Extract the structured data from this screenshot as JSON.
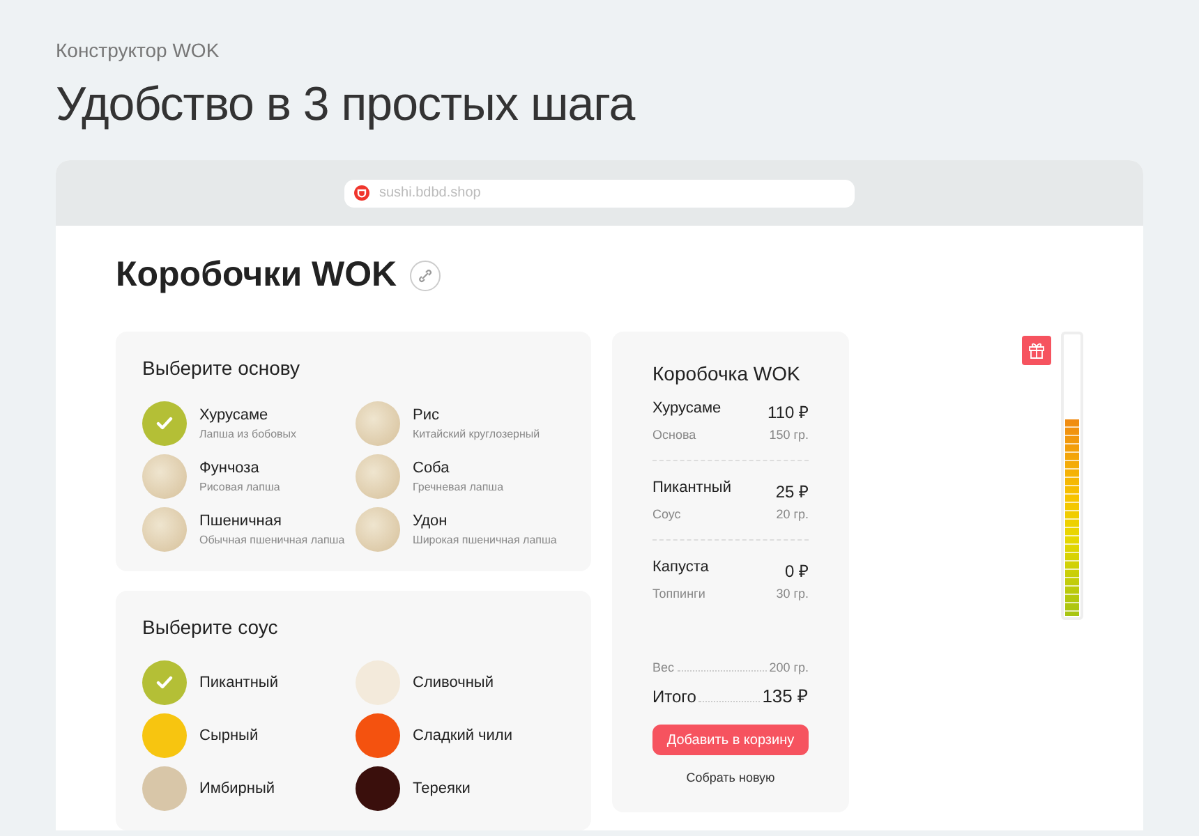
{
  "page": {
    "subtitle": "Конструктор WOK",
    "title": "Удобство в 3 простых шага"
  },
  "browser": {
    "url": "sushi.bdbd.shop"
  },
  "heading": "Коробочки WOK",
  "sections": [
    {
      "title": "Выберите основу",
      "kind": "photo",
      "options": [
        {
          "name": "Хурусаме",
          "description": "Лапша из бобовых",
          "selected": true
        },
        {
          "name": "Рис",
          "description": "Китайский круглозерный",
          "selected": false
        },
        {
          "name": "Фунчоза",
          "description": "Рисовая лапша",
          "selected": false
        },
        {
          "name": "Соба",
          "description": "Гречневая лапша",
          "selected": false
        },
        {
          "name": "Пшеничная",
          "description": "Обычная пшеничная лапша",
          "selected": false
        },
        {
          "name": "Удон",
          "description": "Широкая пшеничная лапша",
          "selected": false
        }
      ]
    },
    {
      "title": "Выберите соус",
      "kind": "swatch",
      "options": [
        {
          "name": "Пикантный",
          "selected": true
        },
        {
          "name": "Сливочный",
          "selected": false,
          "color": "#f3eadb"
        },
        {
          "name": "Сырный",
          "selected": false,
          "color": "#f7c510"
        },
        {
          "name": "Сладкий чили",
          "selected": false,
          "color": "#f4520f"
        },
        {
          "name": "Имбирный",
          "selected": false,
          "color": "#d8c6a8"
        },
        {
          "name": "Тереяки",
          "selected": false,
          "color": "#3a0f0c"
        }
      ]
    }
  ],
  "summary": {
    "title": "Коробочка WOK",
    "items": [
      {
        "name": "Хурусаме",
        "category": "Основа",
        "price": "110 ₽",
        "weight": "150 гр."
      },
      {
        "name": "Пикантный",
        "category": "Соус",
        "price": "25 ₽",
        "weight": "20 гр."
      },
      {
        "name": "Капуста",
        "category": "Топпинги",
        "price": "0 ₽",
        "weight": "30 гр."
      }
    ],
    "weight_label": "Вес",
    "weight": "200 гр.",
    "total_label": "Итого",
    "total": "135 ₽",
    "add_button": "Добавить в корзину",
    "reset_link": "Собрать новую"
  },
  "meter": {
    "level": 0.7
  }
}
